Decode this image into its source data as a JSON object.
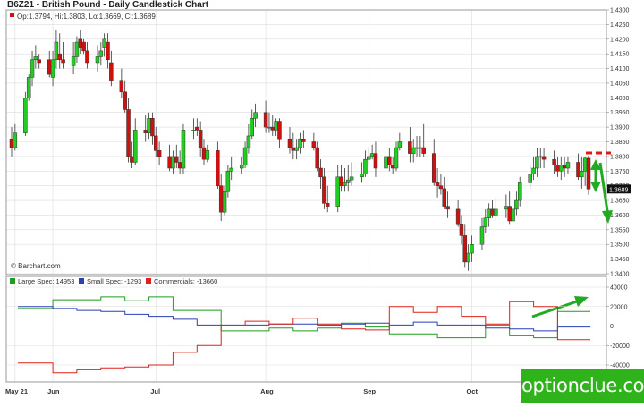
{
  "header": {
    "title": "B6Z21 - British Pound - Daily Candlestick Chart"
  },
  "price_panel": {
    "ohlc_label": "Op:1.3794, Hi:1.3803, Lo:1.3669, Cl:1.3689",
    "source": "© Barchart.com",
    "last_price_tag": "1.3689"
  },
  "cot_panel": {
    "legend": [
      {
        "label": "Large Spec: 14953",
        "color": "#1e9e1e"
      },
      {
        "label": "Small Spec: -1293",
        "color": "#2a3fb8"
      },
      {
        "label": "Commercials: -13660",
        "color": "#e0201a"
      }
    ]
  },
  "watermark": "optionclue.com",
  "colors": {
    "up": "#22cc22",
    "down": "#cc1111",
    "grid": "#dddddd",
    "panel_border": "#999999",
    "arrow": "#22aa22"
  },
  "chart_data": [
    {
      "type": "candlestick",
      "title": "B6Z21 - British Pound - Daily Candlestick Chart",
      "x": [
        "2021-05-20",
        "2021-05-21",
        "2021-05-24",
        "2021-05-25",
        "2021-05-26",
        "2021-05-27",
        "2021-05-28",
        "2021-05-31",
        "2021-06-01",
        "2021-06-02",
        "2021-06-03",
        "2021-06-04",
        "2021-06-07",
        "2021-06-08",
        "2021-06-09",
        "2021-06-10",
        "2021-06-11",
        "2021-06-14",
        "2021-06-15",
        "2021-06-16",
        "2021-06-17",
        "2021-06-18",
        "2021-06-21",
        "2021-06-22",
        "2021-06-23",
        "2021-06-24",
        "2021-06-25",
        "2021-06-28",
        "2021-06-29",
        "2021-06-30",
        "2021-07-01",
        "2021-07-02",
        "2021-07-05",
        "2021-07-06",
        "2021-07-07",
        "2021-07-08",
        "2021-07-09",
        "2021-07-12",
        "2021-07-13",
        "2021-07-14",
        "2021-07-15",
        "2021-07-16",
        "2021-07-19",
        "2021-07-20",
        "2021-07-21",
        "2021-07-22",
        "2021-07-23",
        "2021-07-26",
        "2021-07-27",
        "2021-07-28",
        "2021-07-29",
        "2021-07-30",
        "2021-08-02",
        "2021-08-03",
        "2021-08-04",
        "2021-08-05",
        "2021-08-06",
        "2021-08-09",
        "2021-08-10",
        "2021-08-11",
        "2021-08-12",
        "2021-08-13",
        "2021-08-16",
        "2021-08-17",
        "2021-08-18",
        "2021-08-19",
        "2021-08-20",
        "2021-08-23",
        "2021-08-24",
        "2021-08-25",
        "2021-08-26",
        "2021-08-27",
        "2021-08-30",
        "2021-08-31",
        "2021-09-01",
        "2021-09-02",
        "2021-09-03",
        "2021-09-06",
        "2021-09-07",
        "2021-09-08",
        "2021-09-09",
        "2021-09-10",
        "2021-09-13",
        "2021-09-14",
        "2021-09-15",
        "2021-09-16",
        "2021-09-17",
        "2021-09-20",
        "2021-09-21",
        "2021-09-22",
        "2021-09-23",
        "2021-09-24",
        "2021-09-27",
        "2021-09-28",
        "2021-09-29",
        "2021-09-30",
        "2021-10-01",
        "2021-10-04",
        "2021-10-05",
        "2021-10-06",
        "2021-10-07",
        "2021-10-08",
        "2021-10-11",
        "2021-10-12",
        "2021-10-13",
        "2021-10-14",
        "2021-10-15",
        "2021-10-18",
        "2021-10-19",
        "2021-10-20",
        "2021-10-21",
        "2021-10-22",
        "2021-10-25",
        "2021-10-26",
        "2021-10-27",
        "2021-10-28",
        "2021-10-29",
        "2021-11-01",
        "2021-11-02",
        "2021-11-03",
        "2021-11-04"
      ],
      "open": [
        1.386,
        1.383,
        1.388,
        1.4,
        1.407,
        1.413,
        1.413,
        1.413,
        1.407,
        1.413,
        1.415,
        1.413,
        1.411,
        1.414,
        1.42,
        1.419,
        1.416,
        1.412,
        1.414,
        1.417,
        1.419,
        1.412,
        1.406,
        1.402,
        1.396,
        1.38,
        1.378,
        1.389,
        1.388,
        1.393,
        1.387,
        1.382,
        1.38,
        1.376,
        1.38,
        1.378,
        1.376,
        1.389,
        1.39,
        1.389,
        1.383,
        1.379,
        1.382,
        1.37,
        1.361,
        1.368,
        1.375,
        1.376,
        1.377,
        1.383,
        1.387,
        1.393,
        1.395,
        1.39,
        1.39,
        1.389,
        1.392,
        1.386,
        1.383,
        1.382,
        1.383,
        1.386,
        1.385,
        1.383,
        1.376,
        1.373,
        1.364,
        1.363,
        1.373,
        1.37,
        1.371,
        1.372,
        1.373,
        1.374,
        1.379,
        1.38,
        1.381,
        1.376,
        1.38,
        1.377,
        1.376,
        1.383,
        1.385,
        1.381,
        1.383,
        1.383,
        1.383,
        1.381,
        1.371,
        1.37,
        1.369,
        1.363,
        1.362,
        1.357,
        1.353,
        1.344,
        1.347,
        1.35,
        1.356,
        1.359,
        1.362,
        1.36,
        1.362,
        1.363,
        1.358,
        1.362,
        1.365,
        1.371,
        1.374,
        1.376,
        1.38,
        1.38,
        1.379,
        1.377,
        1.375,
        1.377,
        1.376,
        1.378,
        1.373,
        1.375,
        1.3794
      ],
      "high": [
        1.39,
        1.391,
        1.402,
        1.408,
        1.416,
        1.418,
        1.415,
        1.416,
        1.416,
        1.423,
        1.422,
        1.419,
        1.419,
        1.421,
        1.423,
        1.42,
        1.419,
        1.418,
        1.419,
        1.422,
        1.422,
        1.416,
        1.41,
        1.406,
        1.4,
        1.385,
        1.393,
        1.394,
        1.395,
        1.395,
        1.39,
        1.385,
        1.384,
        1.382,
        1.384,
        1.382,
        1.391,
        1.393,
        1.393,
        1.392,
        1.386,
        1.384,
        1.385,
        1.374,
        1.37,
        1.377,
        1.38,
        1.38,
        1.385,
        1.391,
        1.396,
        1.398,
        1.399,
        1.395,
        1.394,
        1.393,
        1.393,
        1.39,
        1.388,
        1.386,
        1.388,
        1.389,
        1.388,
        1.385,
        1.379,
        1.376,
        1.37,
        1.377,
        1.377,
        1.376,
        1.377,
        1.378,
        1.378,
        1.382,
        1.383,
        1.384,
        1.385,
        1.382,
        1.383,
        1.38,
        1.385,
        1.388,
        1.39,
        1.386,
        1.387,
        1.387,
        1.391,
        1.386,
        1.376,
        1.374,
        1.373,
        1.368,
        1.365,
        1.36,
        1.357,
        1.35,
        1.353,
        1.359,
        1.362,
        1.364,
        1.365,
        1.366,
        1.367,
        1.368,
        1.366,
        1.368,
        1.373,
        1.377,
        1.38,
        1.383,
        1.383,
        1.383,
        1.382,
        1.38,
        1.38,
        1.38,
        1.38,
        1.381,
        1.38,
        1.38,
        1.3803
      ],
      "low": [
        1.38,
        1.382,
        1.387,
        1.399,
        1.404,
        1.41,
        1.41,
        1.407,
        1.404,
        1.41,
        1.41,
        1.41,
        1.408,
        1.412,
        1.415,
        1.415,
        1.41,
        1.409,
        1.411,
        1.414,
        1.41,
        1.404,
        1.4,
        1.395,
        1.378,
        1.376,
        1.377,
        1.385,
        1.386,
        1.384,
        1.38,
        1.377,
        1.375,
        1.374,
        1.376,
        1.374,
        1.374,
        1.386,
        1.387,
        1.38,
        1.377,
        1.378,
        1.369,
        1.358,
        1.36,
        1.366,
        1.372,
        1.374,
        1.376,
        1.381,
        1.386,
        1.39,
        1.388,
        1.388,
        1.387,
        1.387,
        1.383,
        1.381,
        1.379,
        1.379,
        1.381,
        1.383,
        1.382,
        1.375,
        1.369,
        1.362,
        1.361,
        1.361,
        1.368,
        1.368,
        1.368,
        1.37,
        1.371,
        1.373,
        1.377,
        1.379,
        1.373,
        1.374,
        1.375,
        1.374,
        1.375,
        1.382,
        1.378,
        1.378,
        1.38,
        1.38,
        1.38,
        1.37,
        1.366,
        1.367,
        1.362,
        1.359,
        1.356,
        1.35,
        1.342,
        1.341,
        1.344,
        1.348,
        1.354,
        1.356,
        1.359,
        1.358,
        1.359,
        1.357,
        1.356,
        1.36,
        1.363,
        1.369,
        1.372,
        1.373,
        1.376,
        1.376,
        1.374,
        1.373,
        1.372,
        1.373,
        1.374,
        1.372,
        1.369,
        1.37,
        1.3669
      ],
      "close": [
        1.383,
        1.388,
        1.4,
        1.407,
        1.413,
        1.414,
        1.412,
        1.408,
        1.413,
        1.419,
        1.413,
        1.412,
        1.414,
        1.419,
        1.417,
        1.416,
        1.412,
        1.414,
        1.416,
        1.42,
        1.413,
        1.406,
        1.402,
        1.396,
        1.38,
        1.378,
        1.389,
        1.388,
        1.393,
        1.387,
        1.382,
        1.38,
        1.376,
        1.38,
        1.378,
        1.376,
        1.389,
        1.389,
        1.389,
        1.383,
        1.379,
        1.382,
        1.37,
        1.361,
        1.368,
        1.375,
        1.376,
        1.377,
        1.383,
        1.387,
        1.393,
        1.395,
        1.39,
        1.39,
        1.389,
        1.392,
        1.386,
        1.383,
        1.382,
        1.383,
        1.386,
        1.385,
        1.383,
        1.376,
        1.373,
        1.364,
        1.363,
        1.373,
        1.37,
        1.371,
        1.372,
        1.373,
        1.374,
        1.379,
        1.38,
        1.381,
        1.376,
        1.38,
        1.377,
        1.376,
        1.383,
        1.385,
        1.381,
        1.383,
        1.383,
        1.383,
        1.381,
        1.371,
        1.37,
        1.369,
        1.363,
        1.362,
        1.357,
        1.353,
        1.344,
        1.347,
        1.35,
        1.356,
        1.359,
        1.362,
        1.36,
        1.362,
        1.363,
        1.358,
        1.362,
        1.365,
        1.371,
        1.374,
        1.376,
        1.38,
        1.38,
        1.379,
        1.377,
        1.375,
        1.377,
        1.376,
        1.378,
        1.373,
        1.375,
        1.3794,
        1.3689
      ],
      "xlabel": "",
      "ylabel": "",
      "ylim": [
        1.34,
        1.43
      ],
      "yticks": [
        "1.4300",
        "1.4250",
        "1.4200",
        "1.4150",
        "1.4100",
        "1.4050",
        "1.4000",
        "1.3950",
        "1.3900",
        "1.3850",
        "1.3800",
        "1.3750",
        "1.3700",
        "1.3650",
        "1.3600",
        "1.3550",
        "1.3500",
        "1.3450",
        "1.3400"
      ],
      "xtick_labels": [
        "May 21",
        "Jun",
        "Jul",
        "Aug",
        "Sep",
        "Oct"
      ],
      "grid": true,
      "axis_position": "right",
      "annotations": [
        "red dashed resistance line near 1.3820",
        "green double-headed arrow 1.3830 to 1.3730",
        "green arrow pointing down to 1.3550"
      ]
    },
    {
      "type": "step",
      "title": "",
      "weeks": [
        "2021-05-18",
        "2021-05-25",
        "2021-06-01",
        "2021-06-08",
        "2021-06-15",
        "2021-06-22",
        "2021-06-29",
        "2021-07-06",
        "2021-07-13",
        "2021-07-20",
        "2021-07-27",
        "2021-08-03",
        "2021-08-10",
        "2021-08-17",
        "2021-08-24",
        "2021-08-31",
        "2021-09-07",
        "2021-09-14",
        "2021-09-21",
        "2021-09-28",
        "2021-10-05",
        "2021-10-12",
        "2021-10-19",
        "2021-10-26",
        "2021-11-02"
      ],
      "series": [
        {
          "name": "Large Spec: 14953",
          "values": [
            18000,
            18000,
            27000,
            27000,
            30000,
            26000,
            30000,
            16000,
            16000,
            -5000,
            -5000,
            -2000,
            -5000,
            -2000,
            3000,
            -1000,
            -8000,
            -8000,
            -12000,
            -12000,
            1000,
            -10000,
            -12000,
            15000,
            15000
          ]
        },
        {
          "name": "Small Spec: -1293",
          "values": [
            20000,
            20000,
            18000,
            16000,
            15000,
            12000,
            10000,
            7000,
            1000,
            1000,
            1000,
            2000,
            2000,
            1000,
            2000,
            3000,
            1000,
            4000,
            1000,
            1000,
            -2000,
            -3000,
            -5000,
            -1000,
            -1000
          ]
        },
        {
          "name": "Commercials: -13660",
          "values": [
            -38000,
            -38000,
            -48000,
            -45000,
            -43000,
            -42000,
            -40000,
            -27000,
            -20000,
            0,
            5000,
            2000,
            8000,
            2000,
            -3000,
            -4000,
            20000,
            14000,
            20000,
            10000,
            2000,
            25000,
            20000,
            -14000,
            -14000
          ]
        }
      ],
      "ylim": [
        -45000,
        45000
      ],
      "yticks": [
        "40000",
        "20000",
        "0",
        "-20000",
        "-40000"
      ],
      "xlabel": "",
      "ylabel": "",
      "grid": true,
      "legend": "top-left",
      "annotations": [
        "green arrow pointing up-right"
      ]
    }
  ]
}
